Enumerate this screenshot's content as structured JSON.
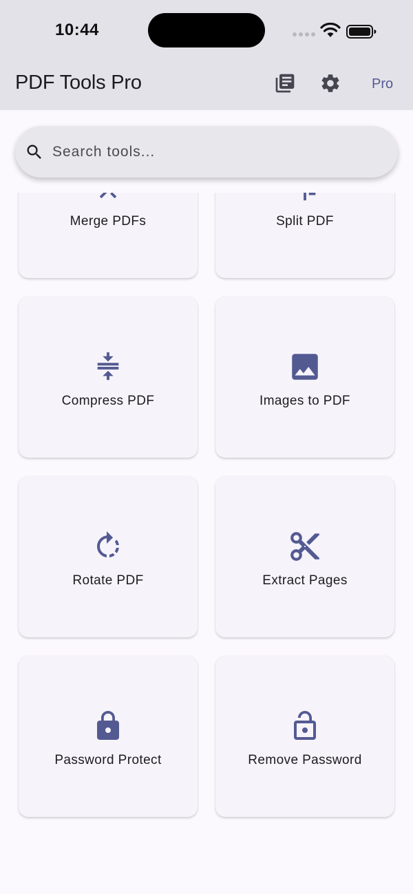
{
  "status": {
    "time": "10:44"
  },
  "appbar": {
    "title": "PDF Tools Pro",
    "pro_label": "Pro"
  },
  "search": {
    "placeholder": "Search tools..."
  },
  "tools": [
    {
      "label": "Merge PDFs",
      "icon": "merge-icon"
    },
    {
      "label": "Split PDF",
      "icon": "split-icon"
    },
    {
      "label": "Compress PDF",
      "icon": "compress-icon"
    },
    {
      "label": "Images to PDF",
      "icon": "image-icon"
    },
    {
      "label": "Rotate PDF",
      "icon": "rotate-icon"
    },
    {
      "label": "Extract Pages",
      "icon": "scissors-icon"
    },
    {
      "label": "Password Protect",
      "icon": "lock-icon"
    },
    {
      "label": "Remove Password",
      "icon": "lock-open-icon"
    }
  ],
  "colors": {
    "accent": "#535a92",
    "card_bg": "#f6f3fa",
    "header_bg": "#e4e2e9"
  }
}
